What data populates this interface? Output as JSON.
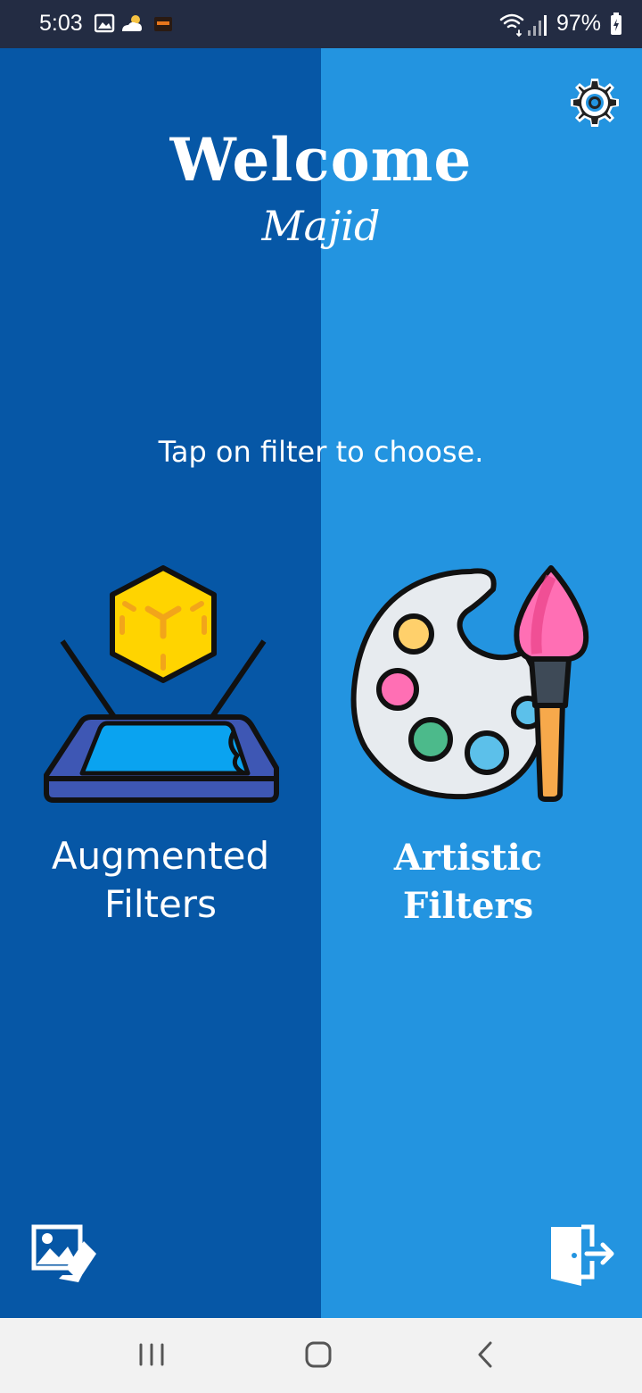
{
  "status_bar": {
    "time": "5:03",
    "battery": "97%",
    "left_icons": [
      "image-notification-icon",
      "weather-icon",
      "app-notification-icon"
    ],
    "right_icons": [
      "wifi-icon",
      "signal-icon",
      "battery-icon"
    ]
  },
  "header": {
    "welcome": "Welcome",
    "username": "Majid",
    "settings_icon": "gear-icon"
  },
  "hint": "Tap on filter to choose.",
  "filters": {
    "augmented": {
      "label_line1": "Augmented",
      "label_line2": "Filters",
      "icon": "ar-cube-phone-icon"
    },
    "artistic": {
      "label_line1": "Artistic",
      "label_line2": "Filters",
      "icon": "paint-palette-icon"
    }
  },
  "footer": {
    "gallery_icon": "gallery-icon",
    "logout_icon": "logout-icon"
  },
  "nav_bar": {
    "recent_icon": "recent-apps-icon",
    "home_icon": "home-icon",
    "back_icon": "back-icon"
  },
  "colors": {
    "left_panel": "#0657a6",
    "right_panel": "#2394e0",
    "status_bar": "#232c43",
    "nav_bar": "#f2f2f2"
  }
}
